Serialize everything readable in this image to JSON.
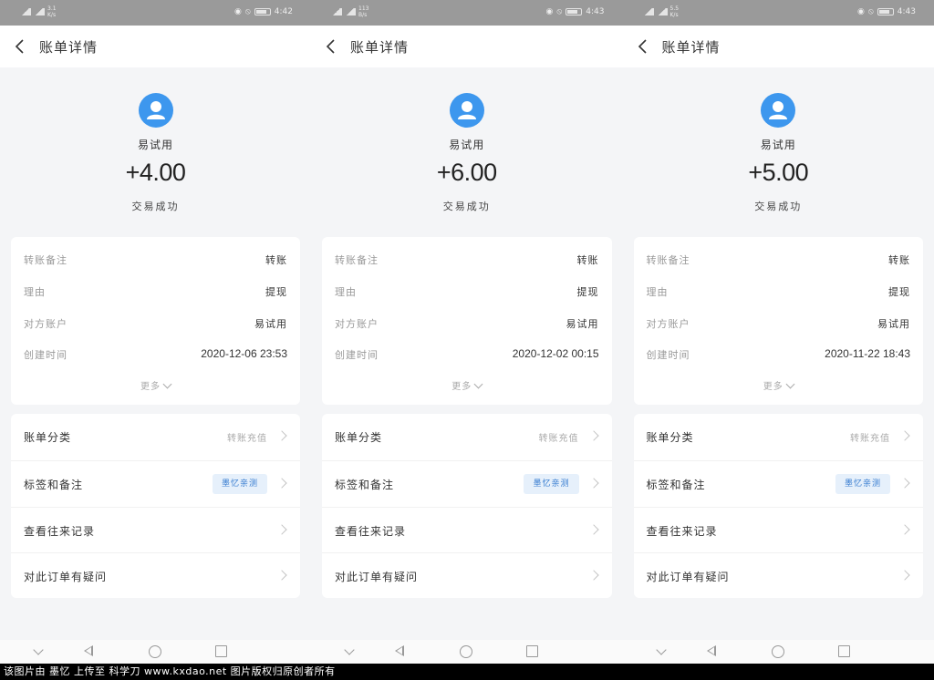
{
  "nav_title": "账单详情",
  "common": {
    "tx_status": "交易成功",
    "labels": {
      "remark": "转账备注",
      "reason": "理由",
      "counterparty": "对方账户",
      "created": "创建时间"
    },
    "more": "更多",
    "menu": {
      "category_label": "账单分类",
      "category_value": "转账充值",
      "tags_label": "标签和备注",
      "tag_value": "墨忆亲测",
      "history_label": "查看往来记录",
      "query_label": "对此订单有疑问"
    }
  },
  "screens": [
    {
      "status_time": "4:42",
      "net_speed": "3.1 K/s",
      "payee": "易试用",
      "amount": "+4.00",
      "remark": "转账",
      "reason": "提现",
      "counterparty": "易试用",
      "created": "2020-12-06 23:53"
    },
    {
      "status_time": "4:43",
      "net_speed": "113 B/s",
      "payee": "易试用",
      "amount": "+6.00",
      "remark": "转账",
      "reason": "提现",
      "counterparty": "易试用",
      "created": "2020-12-02 00:15"
    },
    {
      "status_time": "4:43",
      "net_speed": "5.5 K/s",
      "payee": "易试用",
      "amount": "+5.00",
      "remark": "转账",
      "reason": "提现",
      "counterparty": "易试用",
      "created": "2020-11-22 18:43"
    }
  ],
  "watermark": "该图片由 墨忆 上传至 科学刀 www.kxdao.net 图片版权归原创者所有",
  "colors": {
    "avatar": "#3d97ee",
    "tag_bg": "#e6f0fb",
    "tag_text": "#3a7ed1",
    "statusbar": "#9a9a9a"
  }
}
